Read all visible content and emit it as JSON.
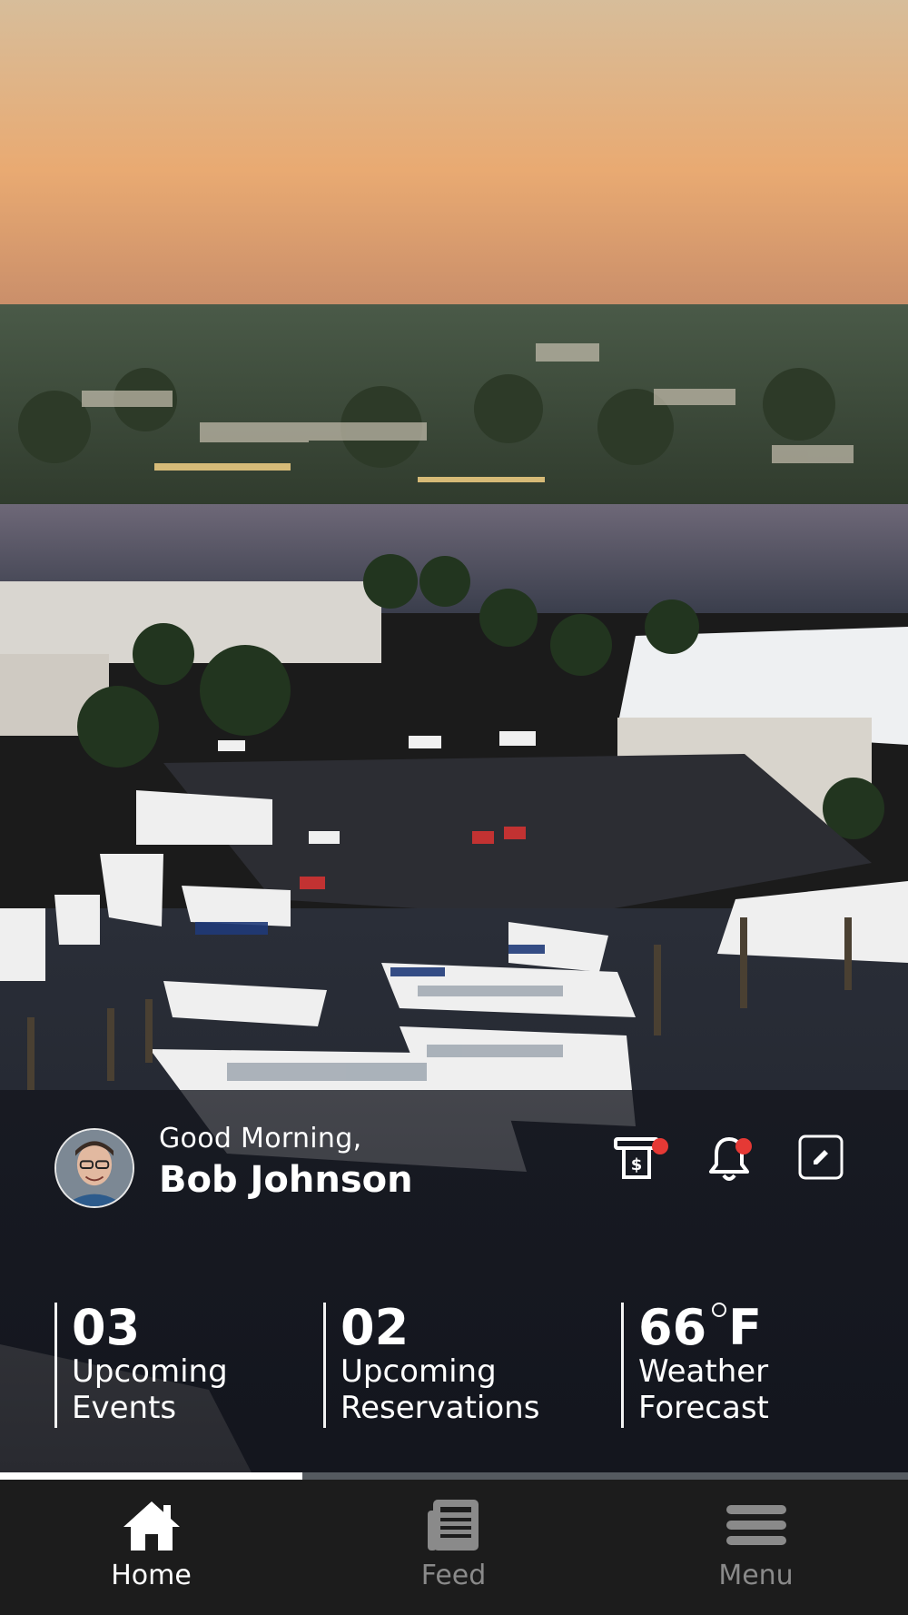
{
  "theme": {
    "panel_bg": "#16181e",
    "nav_bg": "#1c1c1c",
    "active_color": "#ffffff",
    "inactive_color": "#8a8a8a",
    "badge_color": "#e53935"
  },
  "header": {
    "greeting": "Good Morning,",
    "user_name": "Bob Johnson",
    "actions": [
      {
        "name": "billing-icon",
        "has_badge": true
      },
      {
        "name": "bell-icon",
        "has_badge": true
      },
      {
        "name": "edit-icon",
        "has_badge": false
      }
    ]
  },
  "stats": [
    {
      "value": "03",
      "label_line1": "Upcoming",
      "label_line2": "Events"
    },
    {
      "value": "02",
      "label_line1": "Upcoming",
      "label_line2": "Reservations"
    },
    {
      "value": "66",
      "unit": "F",
      "label_line1": "Weather",
      "label_line2": "Forecast"
    }
  ],
  "carousel": {
    "progress": 0.333
  },
  "nav": {
    "items": [
      {
        "label": "Home",
        "icon": "home-icon",
        "active": true
      },
      {
        "label": "Feed",
        "icon": "feed-icon",
        "active": false
      },
      {
        "label": "Menu",
        "icon": "menu-icon",
        "active": false
      }
    ]
  }
}
